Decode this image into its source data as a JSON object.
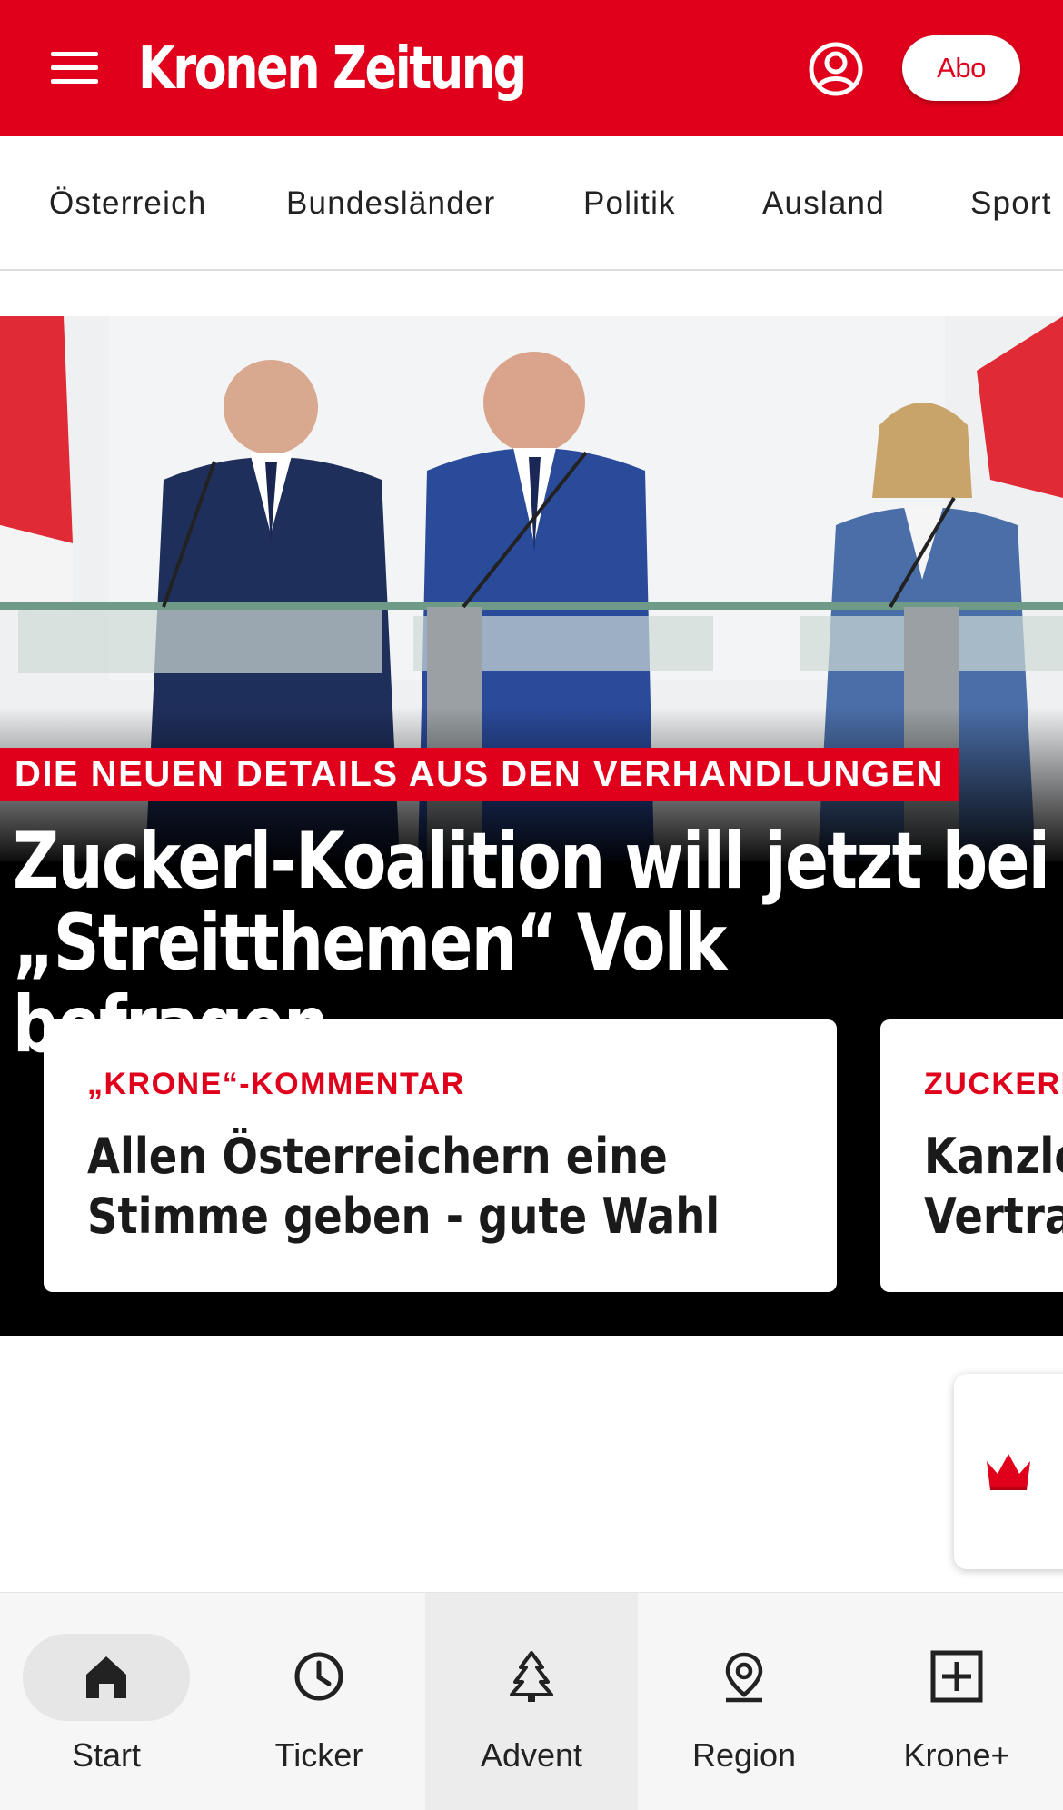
{
  "header": {
    "menu_icon": "hamburger-menu-icon",
    "logo_text": "Kronen Zeitung",
    "user_icon": "user-account-icon",
    "abo_label": "Abo",
    "brand_color": "#e0001b"
  },
  "categories": [
    "Österreich",
    "Bundesländer",
    "Politik",
    "Ausland",
    "Sport"
  ],
  "hero": {
    "kicker": "DIE NEUEN DETAILS AUS DEN VERHANDLUNGEN",
    "headline_line1": "Zuckerl-Koalition will jetzt bei",
    "headline_line2": "„Streitthemen“ Volk befragen"
  },
  "cards": [
    {
      "kicker": "„KRONE“-KOMMENTAR",
      "title_line1": "Allen Österreichern eine",
      "title_line2": "Stimme geben - gute Wahl"
    },
    {
      "kicker": "ZUCKERL",
      "title_line1": "Kanzler",
      "title_line2": "Vertrau"
    }
  ],
  "floating_widget": {
    "icon": "crown-icon"
  },
  "bottom_nav": [
    {
      "label": "Start",
      "icon": "home-icon",
      "selected": true
    },
    {
      "label": "Ticker",
      "icon": "clock-icon"
    },
    {
      "label": "Advent",
      "icon": "tree-icon",
      "highlighted": true
    },
    {
      "label": "Region",
      "icon": "location-pin-icon"
    },
    {
      "label": "Krone+",
      "icon": "plus-box-icon"
    }
  ]
}
